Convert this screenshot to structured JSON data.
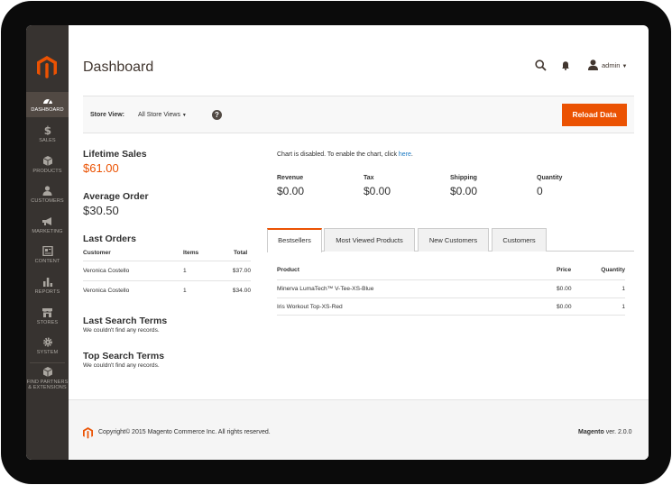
{
  "sidebar": {
    "items": [
      {
        "label": "DASHBOARD",
        "icon": "dashboard-icon"
      },
      {
        "label": "SALES",
        "icon": "dollar-icon"
      },
      {
        "label": "PRODUCTS",
        "icon": "cube-icon"
      },
      {
        "label": "CUSTOMERS",
        "icon": "customers-icon"
      },
      {
        "label": "MARKETING",
        "icon": "megaphone-icon"
      },
      {
        "label": "CONTENT",
        "icon": "content-icon"
      },
      {
        "label": "REPORTS",
        "icon": "bar-chart-icon"
      },
      {
        "label": "STORES",
        "icon": "store-icon"
      },
      {
        "label": "SYSTEM",
        "icon": "gear-icon"
      },
      {
        "label": "FIND PARTNERS",
        "label2": "& EXTENSIONS",
        "icon": "partners-icon"
      }
    ]
  },
  "header": {
    "title": "Dashboard",
    "user": "admin"
  },
  "store_bar": {
    "label": "Store View:",
    "selected": "All Store Views",
    "help": "?",
    "reload_label": "Reload Data"
  },
  "summary": {
    "lifetime_sales_label": "Lifetime Sales",
    "lifetime_sales_value": "$61.00",
    "average_order_label": "Average Order",
    "average_order_value": "$30.50"
  },
  "last_orders": {
    "title": "Last Orders",
    "columns": [
      "Customer",
      "Items",
      "Total"
    ],
    "rows": [
      {
        "customer": "Veronica Costello",
        "items": "1",
        "total": "$37.00"
      },
      {
        "customer": "Veronica Costello",
        "items": "1",
        "total": "$34.00"
      }
    ]
  },
  "last_search": {
    "title": "Last Search Terms",
    "empty": "We couldn't find any records."
  },
  "top_search": {
    "title": "Top Search Terms",
    "empty": "We couldn't find any records."
  },
  "chart": {
    "message": "Chart is disabled. To enable the chart, click ",
    "link": "here",
    "message_end": "."
  },
  "stats": [
    {
      "label": "Revenue",
      "value": "$0.00"
    },
    {
      "label": "Tax",
      "value": "$0.00"
    },
    {
      "label": "Shipping",
      "value": "$0.00"
    },
    {
      "label": "Quantity",
      "value": "0"
    }
  ],
  "tabs": [
    "Bestsellers",
    "Most Viewed Products",
    "New Customers",
    "Customers"
  ],
  "bestsellers": {
    "columns": [
      "Product",
      "Price",
      "Quantity"
    ],
    "rows": [
      {
        "product": "Minerva LumaTech™ V-Tee-XS-Blue",
        "price": "$0.00",
        "quantity": "1"
      },
      {
        "product": "Iris Workout Top-XS-Red",
        "price": "$0.00",
        "quantity": "1"
      }
    ]
  },
  "footer": {
    "copyright": "Copyright© 2015 Magento Commerce Inc. All rights reserved.",
    "brand": "Magento",
    "version": " ver. 2.0.0"
  },
  "colors": {
    "accent": "#eb5202",
    "sidebar": "#373330",
    "link": "#1979c3"
  }
}
